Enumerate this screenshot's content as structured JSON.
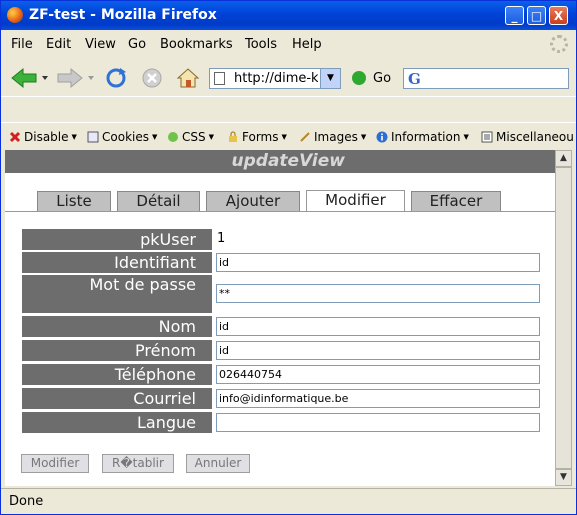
{
  "window": {
    "title": "ZF-test - Mozilla Firefox",
    "minimize": "_",
    "maximize": "□",
    "close": "X"
  },
  "menu": [
    "File",
    "Edit",
    "View",
    "Go",
    "Bookmarks",
    "Tools",
    "Help"
  ],
  "navigation": {
    "url": "http://dime-k",
    "go_label": "Go",
    "search_engine_glyph": "G"
  },
  "devtoolbar": [
    "Disable",
    "Cookies",
    "CSS",
    "Forms",
    "Images",
    "Information",
    "Miscellaneou"
  ],
  "page": {
    "heading": "updateView",
    "tabs": [
      "Liste",
      "Détail",
      "Ajouter",
      "Modifier",
      "Effacer"
    ],
    "active_tab": "Modifier",
    "fields": {
      "pkuser": {
        "label": "pkUser",
        "value": "1"
      },
      "identifiant": {
        "label": "Identifiant",
        "value": "id"
      },
      "motdepasse": {
        "label": "Mot de passe",
        "value": "**"
      },
      "nom": {
        "label": "Nom",
        "value": "id"
      },
      "prenom": {
        "label": "Prénom",
        "value": "id"
      },
      "telephone": {
        "label": "Téléphone",
        "value": "026440754"
      },
      "courriel": {
        "label": "Courriel",
        "value": "info@idinformatique.be"
      },
      "langue": {
        "label": "Langue",
        "value": ""
      }
    },
    "buttons": {
      "modifier": "Modifier",
      "retablir": "R�tablir",
      "annuler": "Annuler"
    }
  },
  "status": "Done",
  "colors": {
    "titlebar": "#0A5FEB",
    "label_bg": "#6D6D6D",
    "chrome_bg": "#ECE9D8"
  }
}
